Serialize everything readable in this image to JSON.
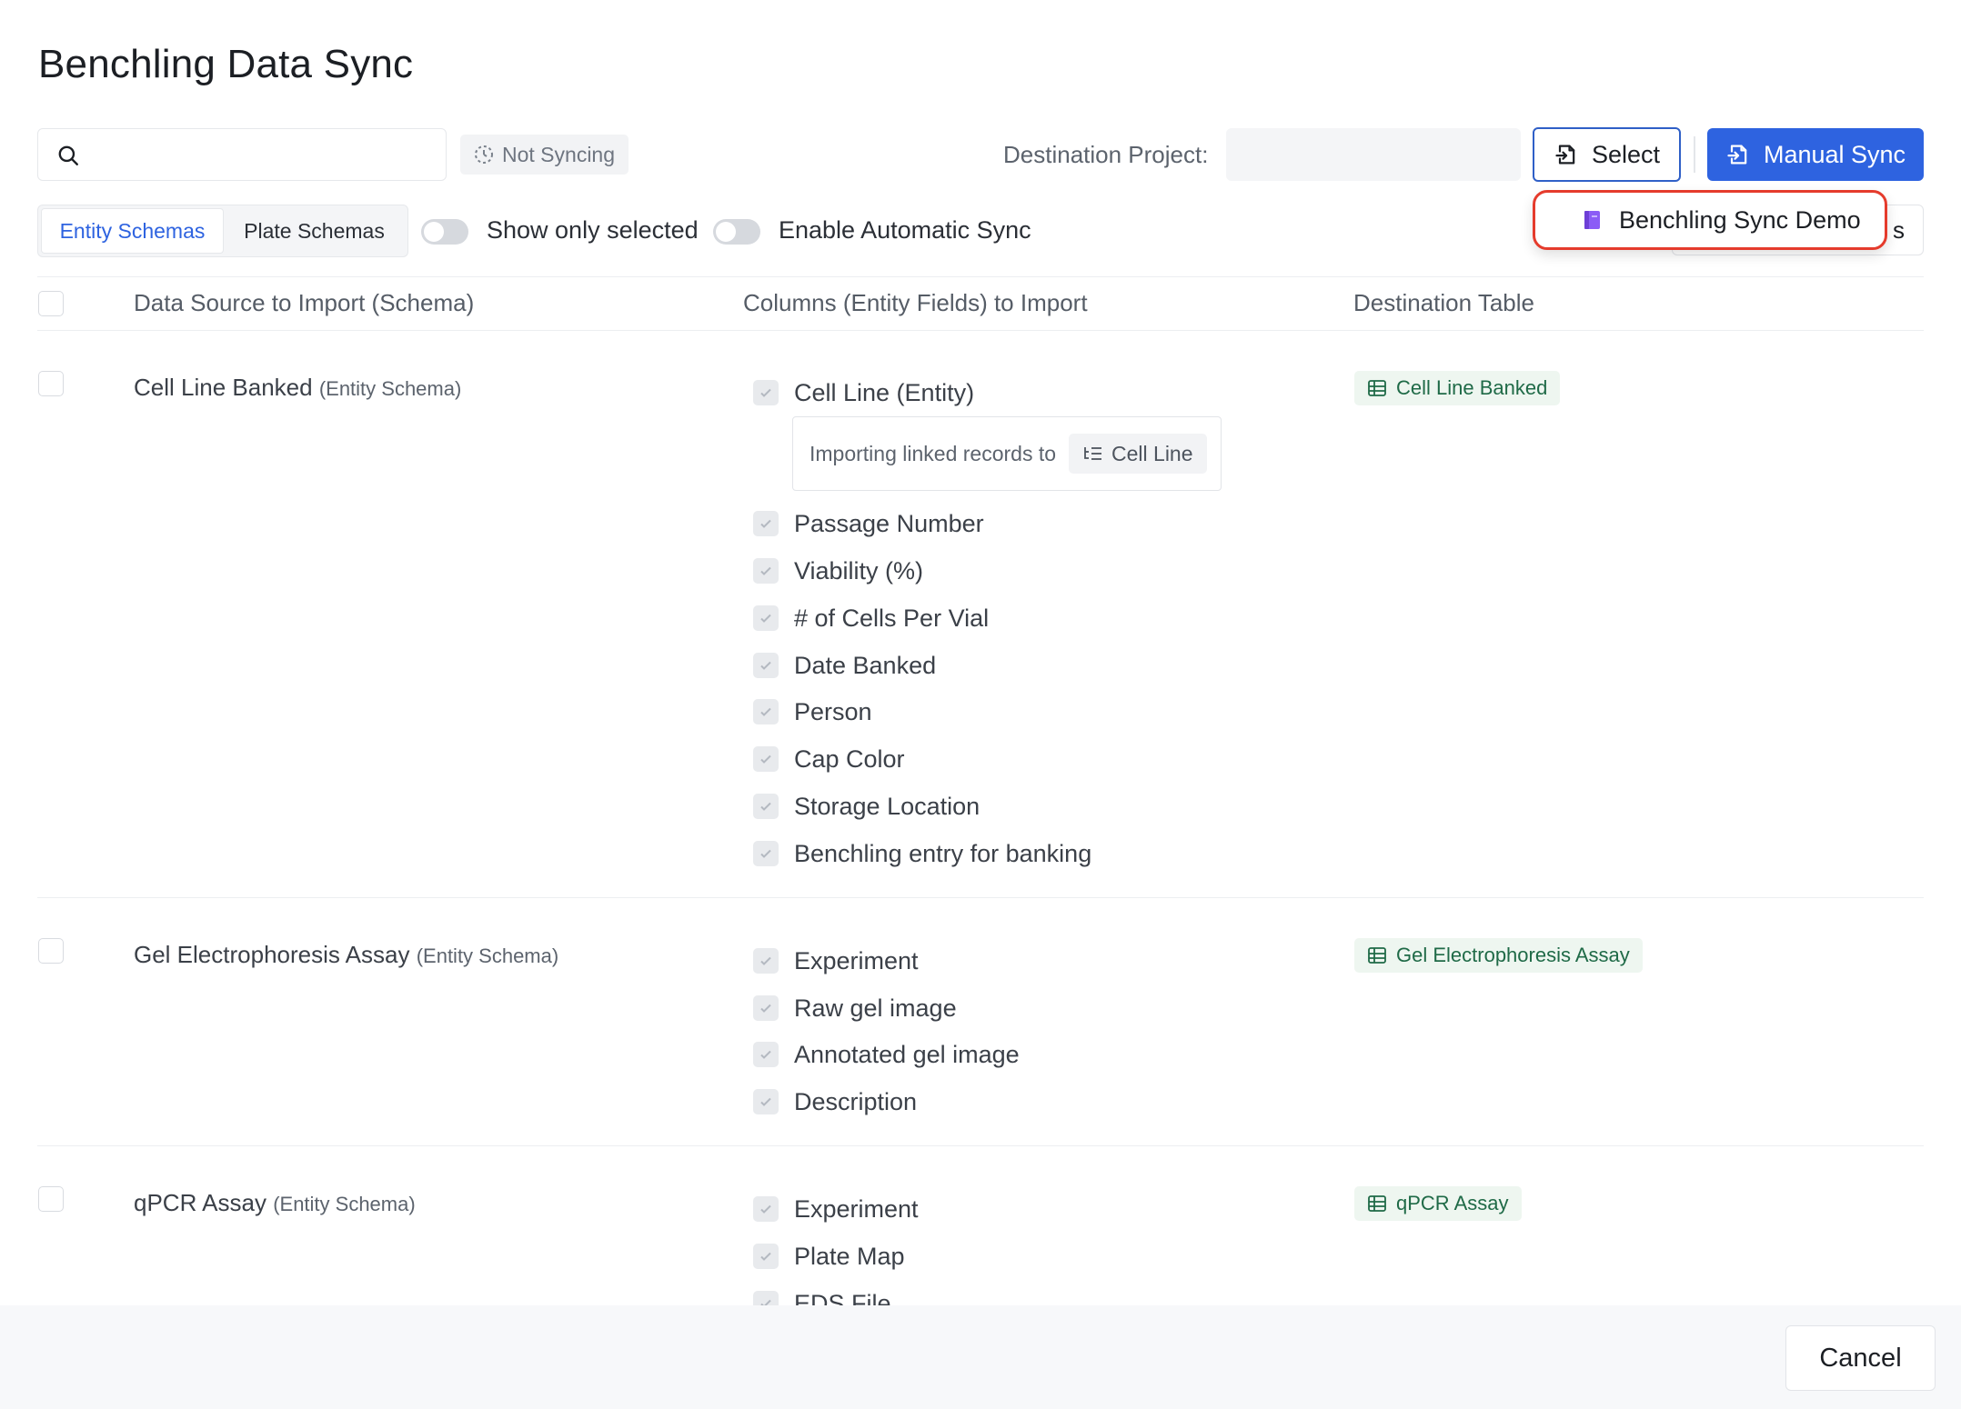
{
  "dialog": {
    "title": "Benchling Data Sync"
  },
  "toolbar": {
    "search_placeholder": "",
    "status_label": "Not Syncing",
    "destination_label": "Destination Project:",
    "destination_value": "",
    "select_label": "Select",
    "manual_sync_label": "Manual Sync",
    "hidden_button_suffix": "s"
  },
  "dropdown": {
    "option_label": "Benchling Sync Demo"
  },
  "filters": {
    "tabs": [
      {
        "label": "Entity Schemas",
        "active": true
      },
      {
        "label": "Plate Schemas",
        "active": false
      }
    ],
    "show_only_selected": {
      "label": "Show only selected",
      "on": false
    },
    "auto_sync": {
      "label": "Enable Automatic Sync",
      "on": false
    }
  },
  "table": {
    "headers": {
      "source": "Data Source to Import (Schema)",
      "columns": "Columns (Entity Fields) to Import",
      "destination": "Destination Table"
    },
    "rows": [
      {
        "name": "Cell Line Banked",
        "type": "(Entity Schema)",
        "destination": "Cell Line Banked",
        "fields": [
          "Cell Line (Entity)",
          "Passage Number",
          "Viability (%)",
          "# of Cells Per Vial",
          "Date Banked",
          "Person",
          "Cap Color",
          "Storage Location",
          "Benchling entry for banking"
        ],
        "link": {
          "text": "Importing linked records to",
          "target": "Cell Line"
        }
      },
      {
        "name": "Gel Electrophoresis Assay",
        "type": "(Entity Schema)",
        "destination": "Gel Electrophoresis Assay",
        "fields": [
          "Experiment",
          "Raw gel image",
          "Annotated gel image",
          "Description"
        ]
      },
      {
        "name": "qPCR Assay",
        "type": "(Entity Schema)",
        "destination": "qPCR Assay",
        "fields": [
          "Experiment",
          "Plate Map",
          "EDS File"
        ]
      }
    ]
  },
  "footer": {
    "cancel_label": "Cancel"
  },
  "colors": {
    "primary": "#2e63e0",
    "highlight": "#e53b2c",
    "destination_text": "#1f6a47"
  }
}
